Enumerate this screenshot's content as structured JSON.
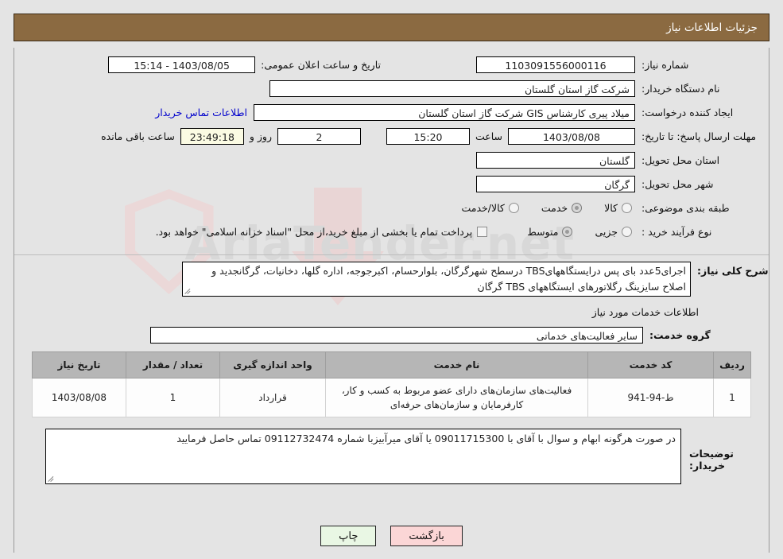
{
  "header": {
    "title": "جزئیات اطلاعات نیاز"
  },
  "info": {
    "need_number_label": "شماره نیاز:",
    "need_number_value": "1103091556000116",
    "public_announce_label": "تاریخ و ساعت اعلان عمومی:",
    "public_announce_value": "1403/08/05 - 15:14",
    "buyer_org_label": "نام دستگاه خریدار:",
    "buyer_org_value": "شرکت گاز استان گلستان",
    "creator_label": "ایجاد کننده درخواست:",
    "creator_value": "میلاد پیری کارشناس GIS شرکت گاز استان گلستان",
    "buyer_contact_link": "اطلاعات تماس خریدار",
    "deadline_label": "مهلت ارسال پاسخ: تا تاریخ:",
    "deadline_date": "1403/08/08",
    "hour_label": "ساعت",
    "deadline_time": "15:20",
    "days_value": "2",
    "days_label": "روز و",
    "countdown_value": "23:49:18",
    "remaining_label": "ساعت باقی مانده",
    "province_label": "استان محل تحویل:",
    "province_value": "گلستان",
    "city_label": "شهر محل تحویل:",
    "city_value": "گرگان",
    "category_label": "طبقه بندی موضوعی:",
    "category_options": [
      {
        "label": "کالا",
        "checked": false
      },
      {
        "label": "خدمت",
        "checked": true
      },
      {
        "label": "کالا/خدمت",
        "checked": false
      }
    ],
    "process_label": "نوع فرآیند خرید :",
    "process_options": [
      {
        "label": "جزیی",
        "checked": false
      },
      {
        "label": "متوسط",
        "checked": true
      }
    ],
    "treasury_checkbox_text": "پرداخت تمام یا بخشی از مبلغ خرید،از محل \"اسناد خزانه اسلامی\" خواهد بود.",
    "treasury_checked": false
  },
  "description": {
    "label": "شرح کلی نیاز:",
    "value": "اجرای5عدد بای پس درایستگاههایTBS درسطح شهرگرگان، بلوارحسام، اکبرجوجه، اداره گلها، دخانیات، گرگانجدید و اصلاح سایزینگ رگلاتورهای ایستگاههای TBS گرگان"
  },
  "services_section": {
    "title": "اطلاعات خدمات مورد نیاز",
    "group_label": "گروه خدمت:",
    "group_value": "سایر فعالیت‌های خدماتی"
  },
  "table": {
    "headers": [
      "ردیف",
      "کد خدمت",
      "نام خدمت",
      "واحد اندازه گیری",
      "تعداد / مقدار",
      "تاریخ نیاز"
    ],
    "rows": [
      {
        "radif": "1",
        "code": "ط-94-941",
        "name": "فعالیت‌های سازمان‌های دارای عضو مربوط به کسب و کار، کارفرمایان و سازمان‌های حرفه‌ای",
        "unit": "قرارداد",
        "quantity": "1",
        "date": "1403/08/08"
      }
    ]
  },
  "buyer_notes": {
    "label": "توضیحات خریدار:",
    "value": "در صورت هرگونه ابهام و سوال با آقای با 09011715300 یا آقای میرآبیزبا شماره 09112732474 تماس حاصل فرمایید"
  },
  "buttons": {
    "print": "چاپ",
    "back": "بازگشت"
  },
  "watermark": {
    "text": "AriaTender.net"
  },
  "colors": {
    "header_bg": "#8b6a41",
    "page_bg": "#e4e4e4",
    "link": "#0000cc",
    "countdown_bg": "#fbfbe3",
    "table_header_bg": "#b6b6b6",
    "btn_print_bg": "#e9f7e4",
    "btn_back_bg": "#fbd6d6"
  }
}
